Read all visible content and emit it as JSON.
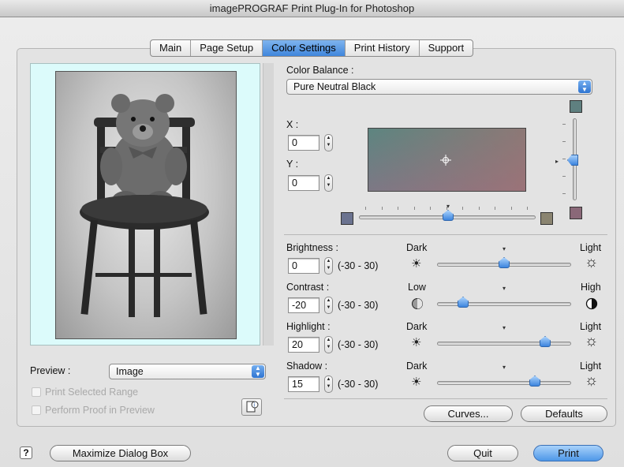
{
  "window": {
    "title": "imagePROGRAF Print Plug-In for Photoshop"
  },
  "tabs": [
    {
      "label": "Main"
    },
    {
      "label": "Page Setup"
    },
    {
      "label": "Color Settings",
      "active": true
    },
    {
      "label": "Print History"
    },
    {
      "label": "Support"
    }
  ],
  "preview": {
    "label": "Preview :",
    "mode_value": "Image",
    "print_selected_range_label": "Print Selected Range",
    "print_selected_range_checked": false,
    "perform_proof_label": "Perform Proof in Preview",
    "perform_proof_checked": false
  },
  "color_balance": {
    "label": "Color Balance :",
    "value": "Pure Neutral Black",
    "x_label": "X :",
    "x_value": "0",
    "y_label": "Y :",
    "y_value": "0"
  },
  "adjustments": [
    {
      "label": "Brightness :",
      "value": "0",
      "range": "(-30 - 30)",
      "low_label": "Dark",
      "high_label": "Light",
      "level": 0
    },
    {
      "label": "Contrast :",
      "value": "-20",
      "range": "(-30 - 30)",
      "low_label": "Low",
      "high_label": "High",
      "level": -20
    },
    {
      "label": "Highlight :",
      "value": "20",
      "range": "(-30 - 30)",
      "low_label": "Dark",
      "high_label": "Light",
      "level": 20
    },
    {
      "label": "Shadow :",
      "value": "15",
      "range": "(-30 - 30)",
      "low_label": "Dark",
      "high_label": "Light",
      "level": 15
    }
  ],
  "buttons": {
    "curves": "Curves...",
    "defaults": "Defaults",
    "maximize": "Maximize Dialog Box",
    "quit": "Quit",
    "print": "Print",
    "help_symbol": "?"
  },
  "colors": {
    "accent": "#3f86dc",
    "preview_bg": "#dcfbfb",
    "swatch_left": "#6b7390",
    "swatch_right": "#8a8470",
    "swatch_top": "#5f8080",
    "swatch_bottom": "#8a6878"
  },
  "icons": {
    "low_brightness": "sun-small-icon",
    "high_brightness": "sun-large-icon",
    "low_contrast": "half-circle-low-icon",
    "high_contrast": "half-circle-high-icon",
    "proof_info": "document-info-icon"
  }
}
